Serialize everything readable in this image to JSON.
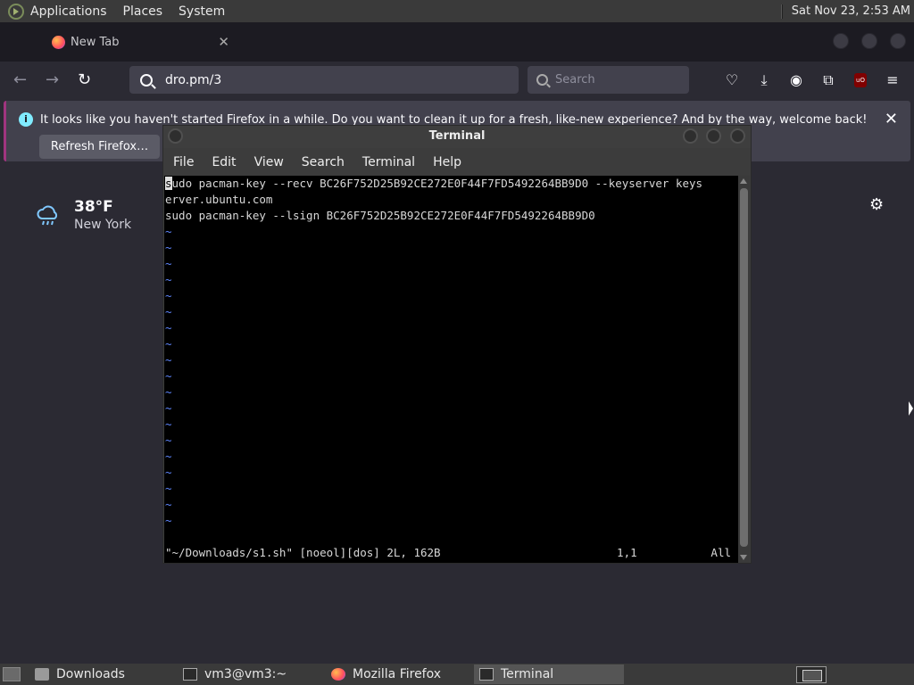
{
  "top_panel": {
    "menus": [
      "Applications",
      "Places",
      "System"
    ],
    "clock": "Sat Nov 23,  2:53 AM"
  },
  "browser": {
    "tab_title": "New Tab",
    "url": "dro.pm/3",
    "search_placeholder": "Search",
    "notice_text": "It looks like you haven't started Firefox in a while. Do you want to clean it up for a fresh, like-new experience? And by the way, welcome back!",
    "refresh_button": "Refresh Firefox…",
    "weather_temp": "38°F",
    "weather_city": "New York"
  },
  "terminal": {
    "title": "Terminal",
    "menu": [
      "File",
      "Edit",
      "View",
      "Search",
      "Terminal",
      "Help"
    ],
    "lines": [
      "sudo pacman-key --recv BC26F752D25B92CE272E0F44F7FD5492264BB9D0 --keyserver keys",
      "erver.ubuntu.com",
      "sudo pacman-key --lsign BC26F752D25B92CE272E0F44F7FD5492264BB9D0"
    ],
    "empty_marker": "~",
    "status": "\"~/Downloads/s1.sh\" [noeol][dos] 2L, 162B",
    "cursor_pos": "1,1",
    "scroll_pos": "All"
  },
  "taskbar": {
    "items": [
      "Downloads",
      "vm3@vm3:~",
      "Mozilla Firefox",
      "Terminal"
    ]
  }
}
